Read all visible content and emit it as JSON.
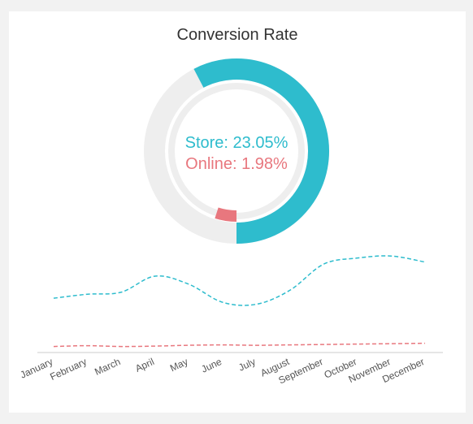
{
  "title": "Conversion Rate",
  "colors": {
    "store": "#2ebccd",
    "online": "#e8777e",
    "track": "#eeeeee",
    "axis": "#cccccc",
    "tick_text": "#555555"
  },
  "chart_data": [
    {
      "type": "donut",
      "title": "Conversion Rate",
      "series": [
        {
          "name": "Store",
          "label": "Store: 23.05%",
          "value": 23.05,
          "unit": "%"
        },
        {
          "name": "Online",
          "label": "Online: 1.98%",
          "value": 1.98,
          "unit": "%"
        }
      ]
    },
    {
      "type": "line",
      "categories": [
        "January",
        "February",
        "March",
        "April",
        "May",
        "June",
        "July",
        "August",
        "September",
        "October",
        "November",
        "December"
      ],
      "series": [
        {
          "name": "Store",
          "values": [
            13.5,
            14.5,
            15,
            19,
            17,
            12.5,
            12,
            15.5,
            22,
            23.5,
            24,
            22.5
          ]
        },
        {
          "name": "Online",
          "values": [
            1.5,
            1.7,
            1.5,
            1.6,
            1.8,
            1.9,
            1.8,
            1.9,
            2.0,
            2.1,
            2.2,
            2.3
          ]
        }
      ],
      "ylim": [
        0,
        40
      ],
      "line_style": "dashed"
    }
  ]
}
